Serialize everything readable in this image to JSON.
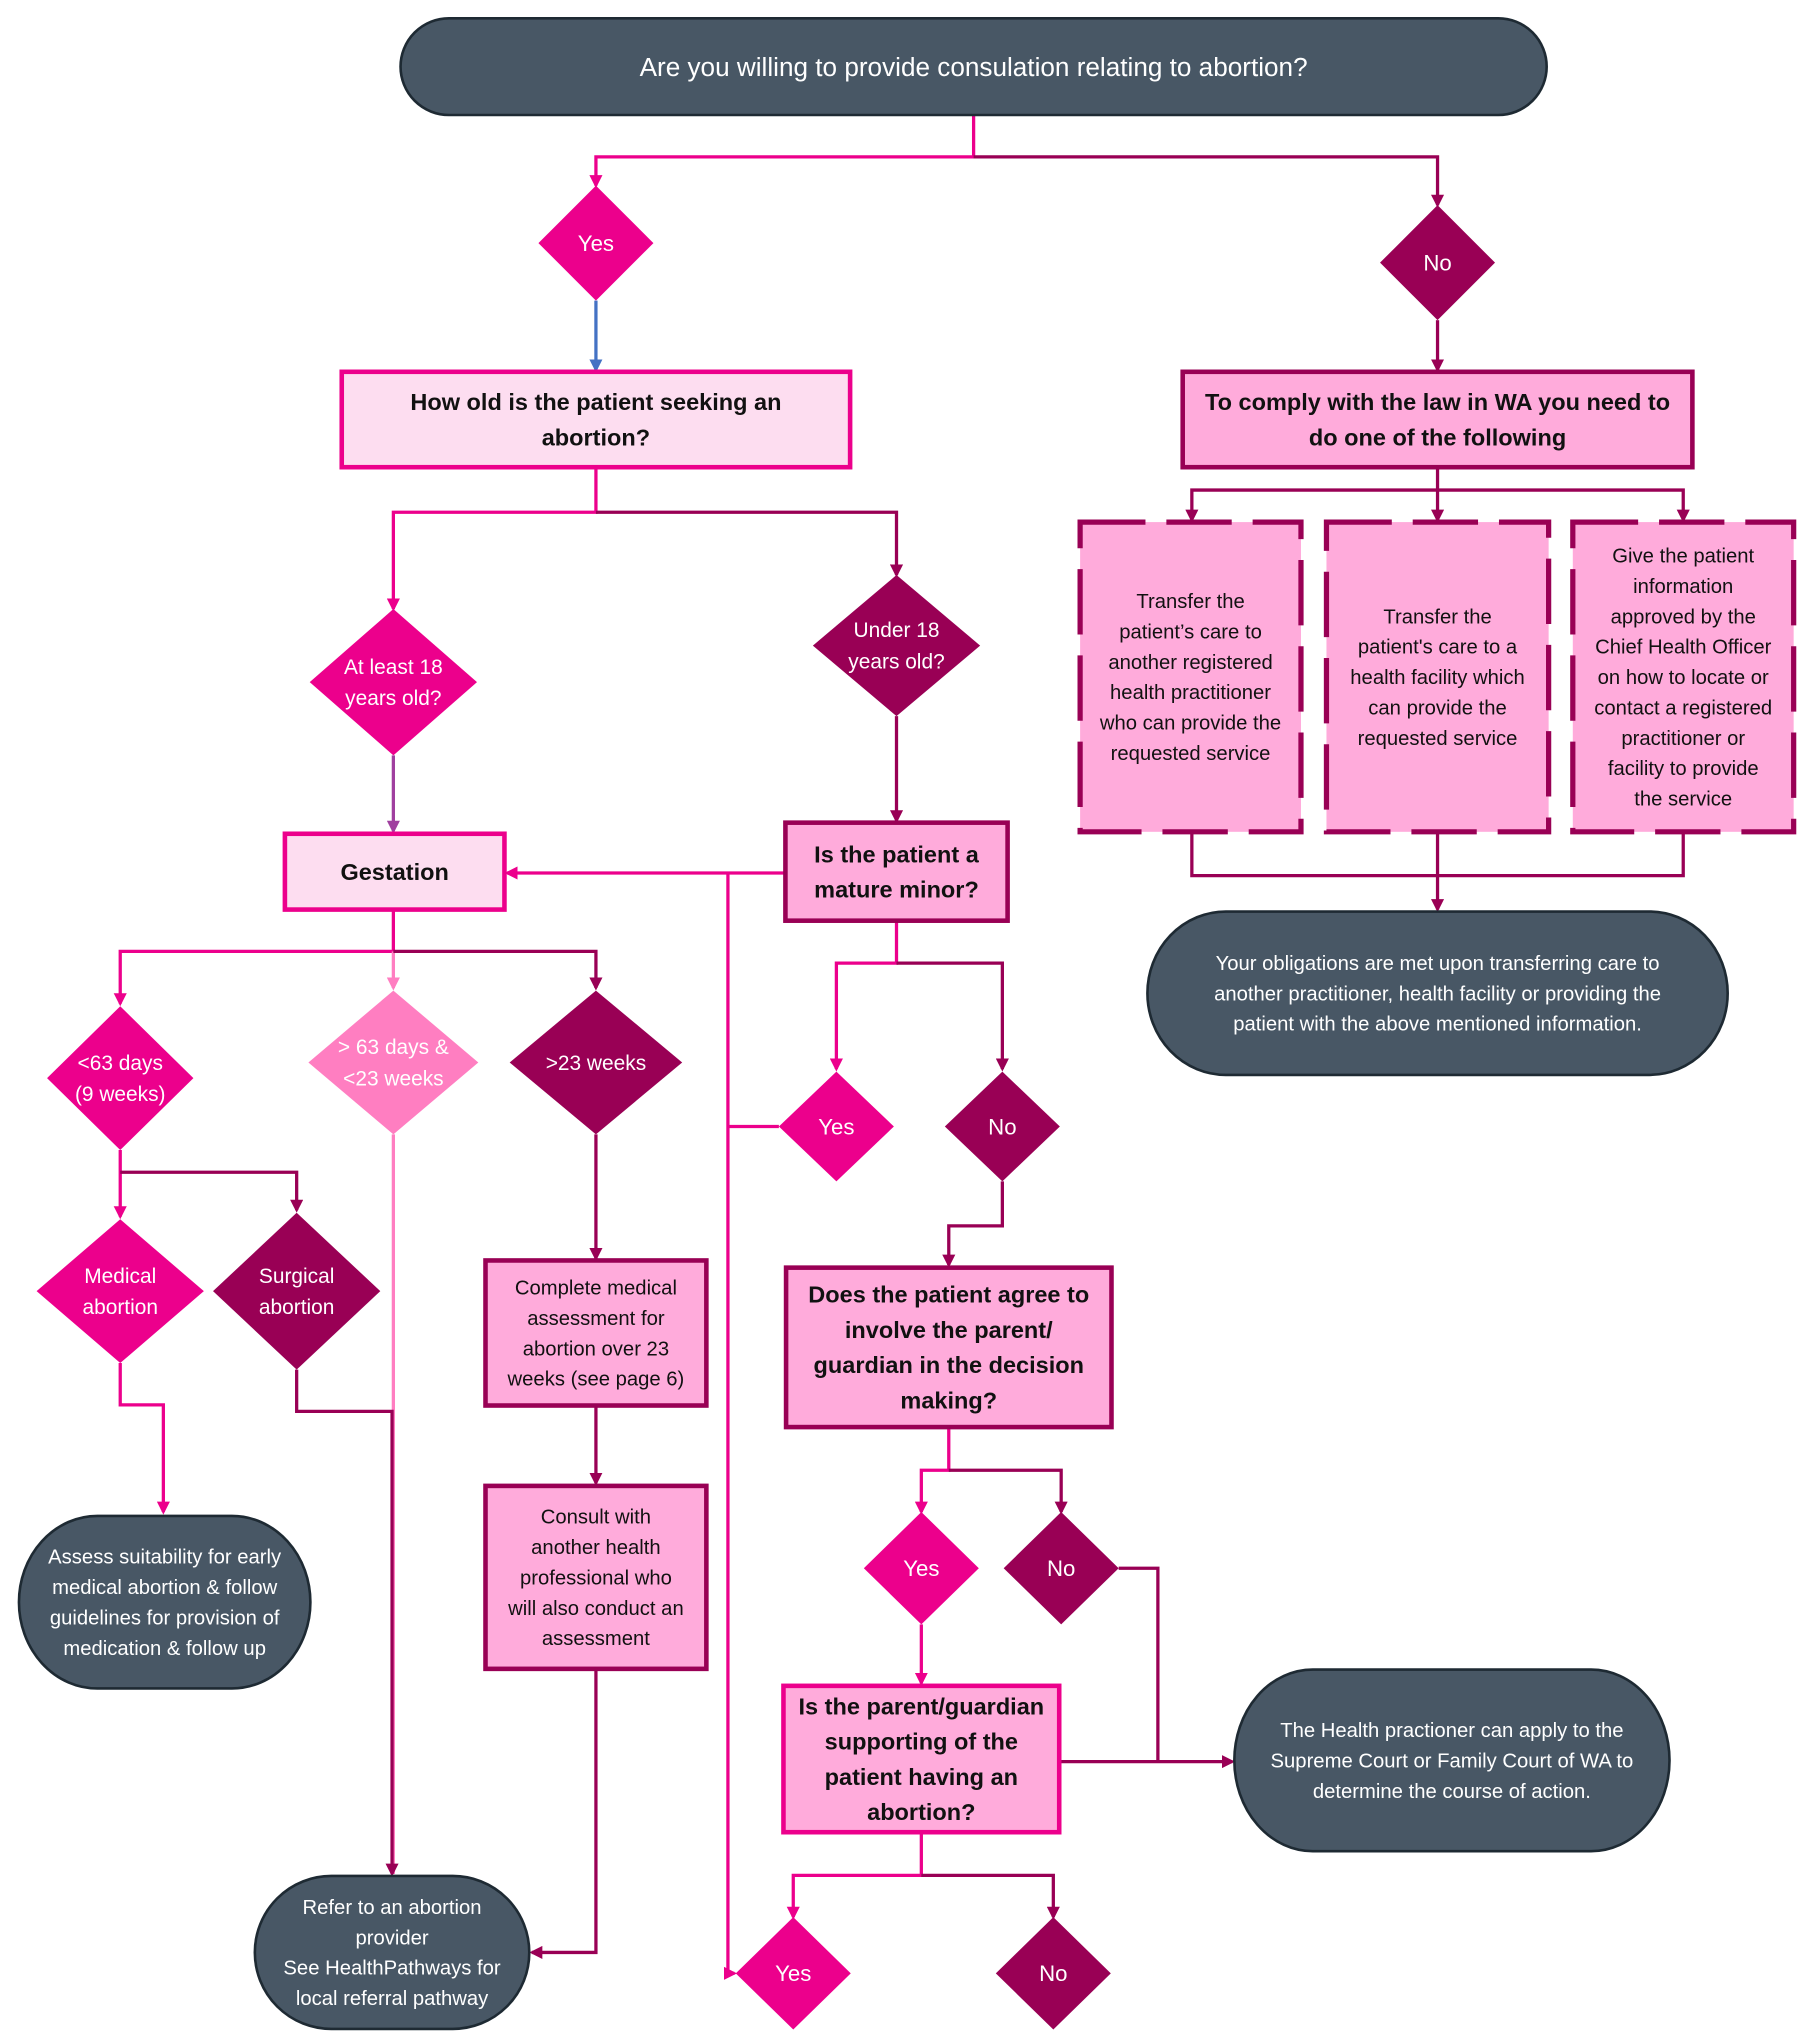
{
  "colors": {
    "dark_slate": "#485765",
    "hot_pink": "#EC008C",
    "dark_magenta": "#990055",
    "light_pink_fill": "#FDDDF0",
    "medium_pink_fill": "#FFABDB",
    "soft_pink_diamond": "#FF7EC1",
    "blue_connector": "#4472C4",
    "purple_connector": "#A0409F"
  },
  "nodes": {
    "start": {
      "lines": [
        "Are you willing to provide consulation relating to abortion?"
      ]
    },
    "yes_consult": {
      "lines": [
        "Yes"
      ]
    },
    "no_consult": {
      "lines": [
        "No"
      ]
    },
    "how_old": {
      "lines": [
        "How old is the patient seeking an",
        "abortion?"
      ]
    },
    "comply_law": {
      "lines": [
        "To comply with the law in WA you need to",
        "do one of the following"
      ]
    },
    "option_transfer_practitioner": {
      "lines": [
        "Transfer the",
        "patient’s care to",
        "another registered",
        "health practitioner",
        "who can provide the",
        "requested service"
      ]
    },
    "option_transfer_facility": {
      "lines": [
        "Transfer the",
        "patient's care to a",
        "health facility which",
        "can provide the",
        "requested service"
      ]
    },
    "option_give_info": {
      "lines": [
        "Give the patient",
        "information",
        "approved by the",
        "Chief Health Officer",
        "on how to locate or",
        "contact a registered",
        "practitioner or",
        "facility to provide",
        "the service"
      ]
    },
    "obligations_met": {
      "lines": [
        "Your obligations are met upon transferring care to",
        "another practitioner, health facility or providing the",
        "patient with the above mentioned information."
      ]
    },
    "at_least_18": {
      "lines": [
        "At least 18",
        "years old?"
      ]
    },
    "under_18": {
      "lines": [
        "Under 18",
        "years old?"
      ]
    },
    "gestation": {
      "lines": [
        "Gestation"
      ]
    },
    "mature_minor": {
      "lines": [
        "Is the patient a",
        "mature minor?"
      ]
    },
    "lt63": {
      "lines": [
        "<63 days",
        "(9 weeks)"
      ]
    },
    "gt63_lt23": {
      "lines": [
        "> 63 days &",
        "<23 weeks"
      ]
    },
    "gt23": {
      "lines": [
        ">23 weeks"
      ]
    },
    "mature_yes": {
      "lines": [
        "Yes"
      ]
    },
    "mature_no": {
      "lines": [
        "No"
      ]
    },
    "medical_abortion": {
      "lines": [
        "Medical",
        "abortion"
      ]
    },
    "surgical_abortion": {
      "lines": [
        "Surgical",
        "abortion"
      ]
    },
    "complete_assessment": {
      "lines": [
        "Complete medical",
        "assessment for",
        "abortion over 23",
        "weeks (see page 6)"
      ]
    },
    "consult_professional": {
      "lines": [
        "Consult with",
        "another health",
        "professional who",
        "will also conduct an",
        "assessment"
      ]
    },
    "involve_parent": {
      "lines": [
        "Does the patient agree to",
        "involve the parent/",
        "guardian in the decision",
        "making?"
      ]
    },
    "involve_yes": {
      "lines": [
        "Yes"
      ]
    },
    "involve_no": {
      "lines": [
        "No"
      ]
    },
    "parent_supporting": {
      "lines": [
        "Is the parent/guardian",
        "supporting of the",
        "patient having an",
        "abortion?"
      ]
    },
    "court": {
      "lines": [
        "The Health practioner can apply to the",
        "Supreme Court or Family Court of WA to",
        "determine the course of action."
      ]
    },
    "assess_suitability": {
      "lines": [
        "Assess suitability for early",
        "medical abortion & follow",
        "guidelines for provision of",
        "medication & follow up"
      ]
    },
    "refer_provider": {
      "lines": [
        "Refer to an abortion",
        "provider",
        "See HealthPathways for",
        "local referral pathway"
      ]
    },
    "support_yes": {
      "lines": [
        "Yes"
      ]
    },
    "support_no": {
      "lines": [
        "No"
      ]
    }
  }
}
